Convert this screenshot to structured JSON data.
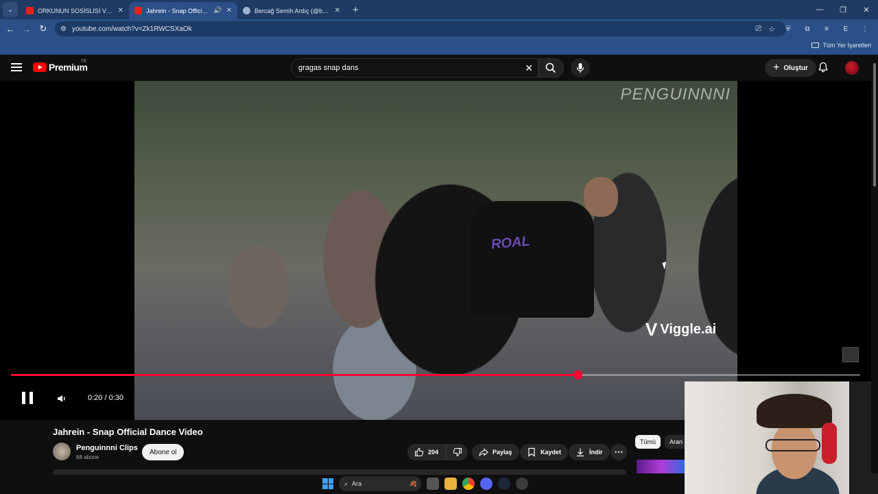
{
  "browser": {
    "tabs": [
      {
        "title": "ORKUNUN SOSİSLİSİ VE SOSU !",
        "active": false
      },
      {
        "title": "Jahrein - Snap Official Dance",
        "active": true
      },
      {
        "title": "Bercağ Semih Ardıç (@bercag_",
        "active": false
      }
    ],
    "url": "youtube.com/watch?v=Zk1RWCSXaOk",
    "bookmarks_all": "Tüm Yer İşaretleri",
    "profile_initial": "E"
  },
  "youtube": {
    "logo_text": "Premium",
    "country": "TR",
    "search_value": "gragas snap dans",
    "create_label": "Oluştur"
  },
  "player": {
    "watermark": "PENGUINNNI",
    "brand": "Viggle.ai",
    "time": "0:20 / 0:30",
    "progress_fraction": 0.667
  },
  "video": {
    "title": "Jahrein - Snap Official Dance Video",
    "channel": "Penguinnni Clips",
    "subscribers": "68 abone",
    "subscribe_label": "Abone ol",
    "likes": "204",
    "share_label": "Paylaş",
    "save_label": "Kaydet",
    "download_label": "İndir"
  },
  "chips": [
    "Tümü",
    "Aran"
  ],
  "taskbar": {
    "search_label": "Ara"
  },
  "colors": {
    "accent": "#ff0033",
    "chrome": "#2b4f86",
    "yt_red": "#ff0000"
  }
}
